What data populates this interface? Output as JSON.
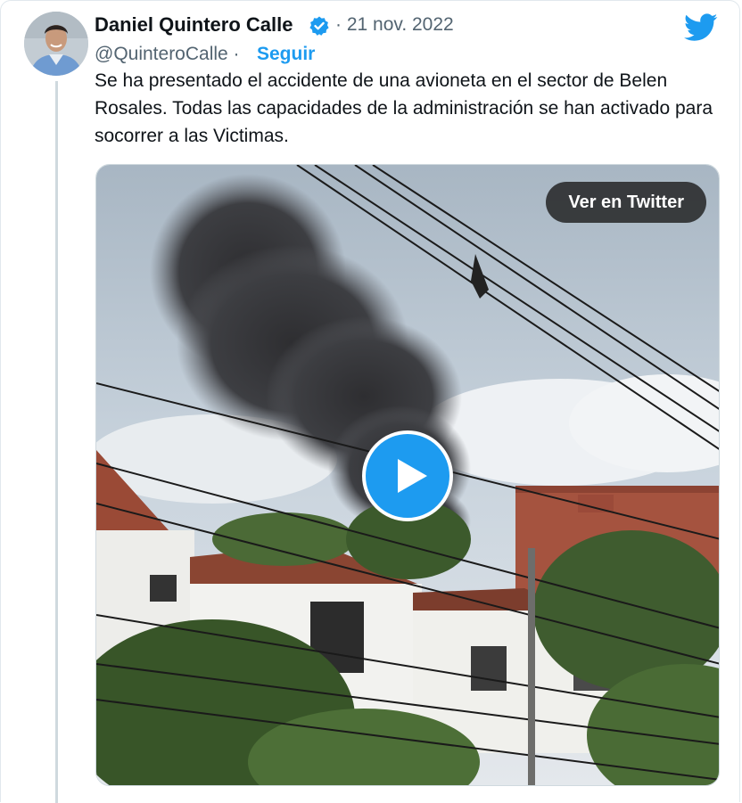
{
  "tweet": {
    "author_name": "Daniel Quintero Calle",
    "date": "· 21 nov. 2022",
    "handle": "@QuinteroCalle ·",
    "follow_label": "Seguir",
    "text": "Se ha presentado el accidente de una avioneta en el sector de Belen Rosales. Todas las capacidades de la administración se han activado para socorrer a las Victimas.",
    "media": {
      "view_button_label": "Ver en Twitter"
    }
  },
  "icons": {
    "verified": "verified-badge-icon",
    "logo": "twitter-bird-icon",
    "play": "play-icon"
  },
  "colors": {
    "accent": "#1d9bf0",
    "secondary_text": "#536471",
    "primary_text": "#0f1419"
  }
}
